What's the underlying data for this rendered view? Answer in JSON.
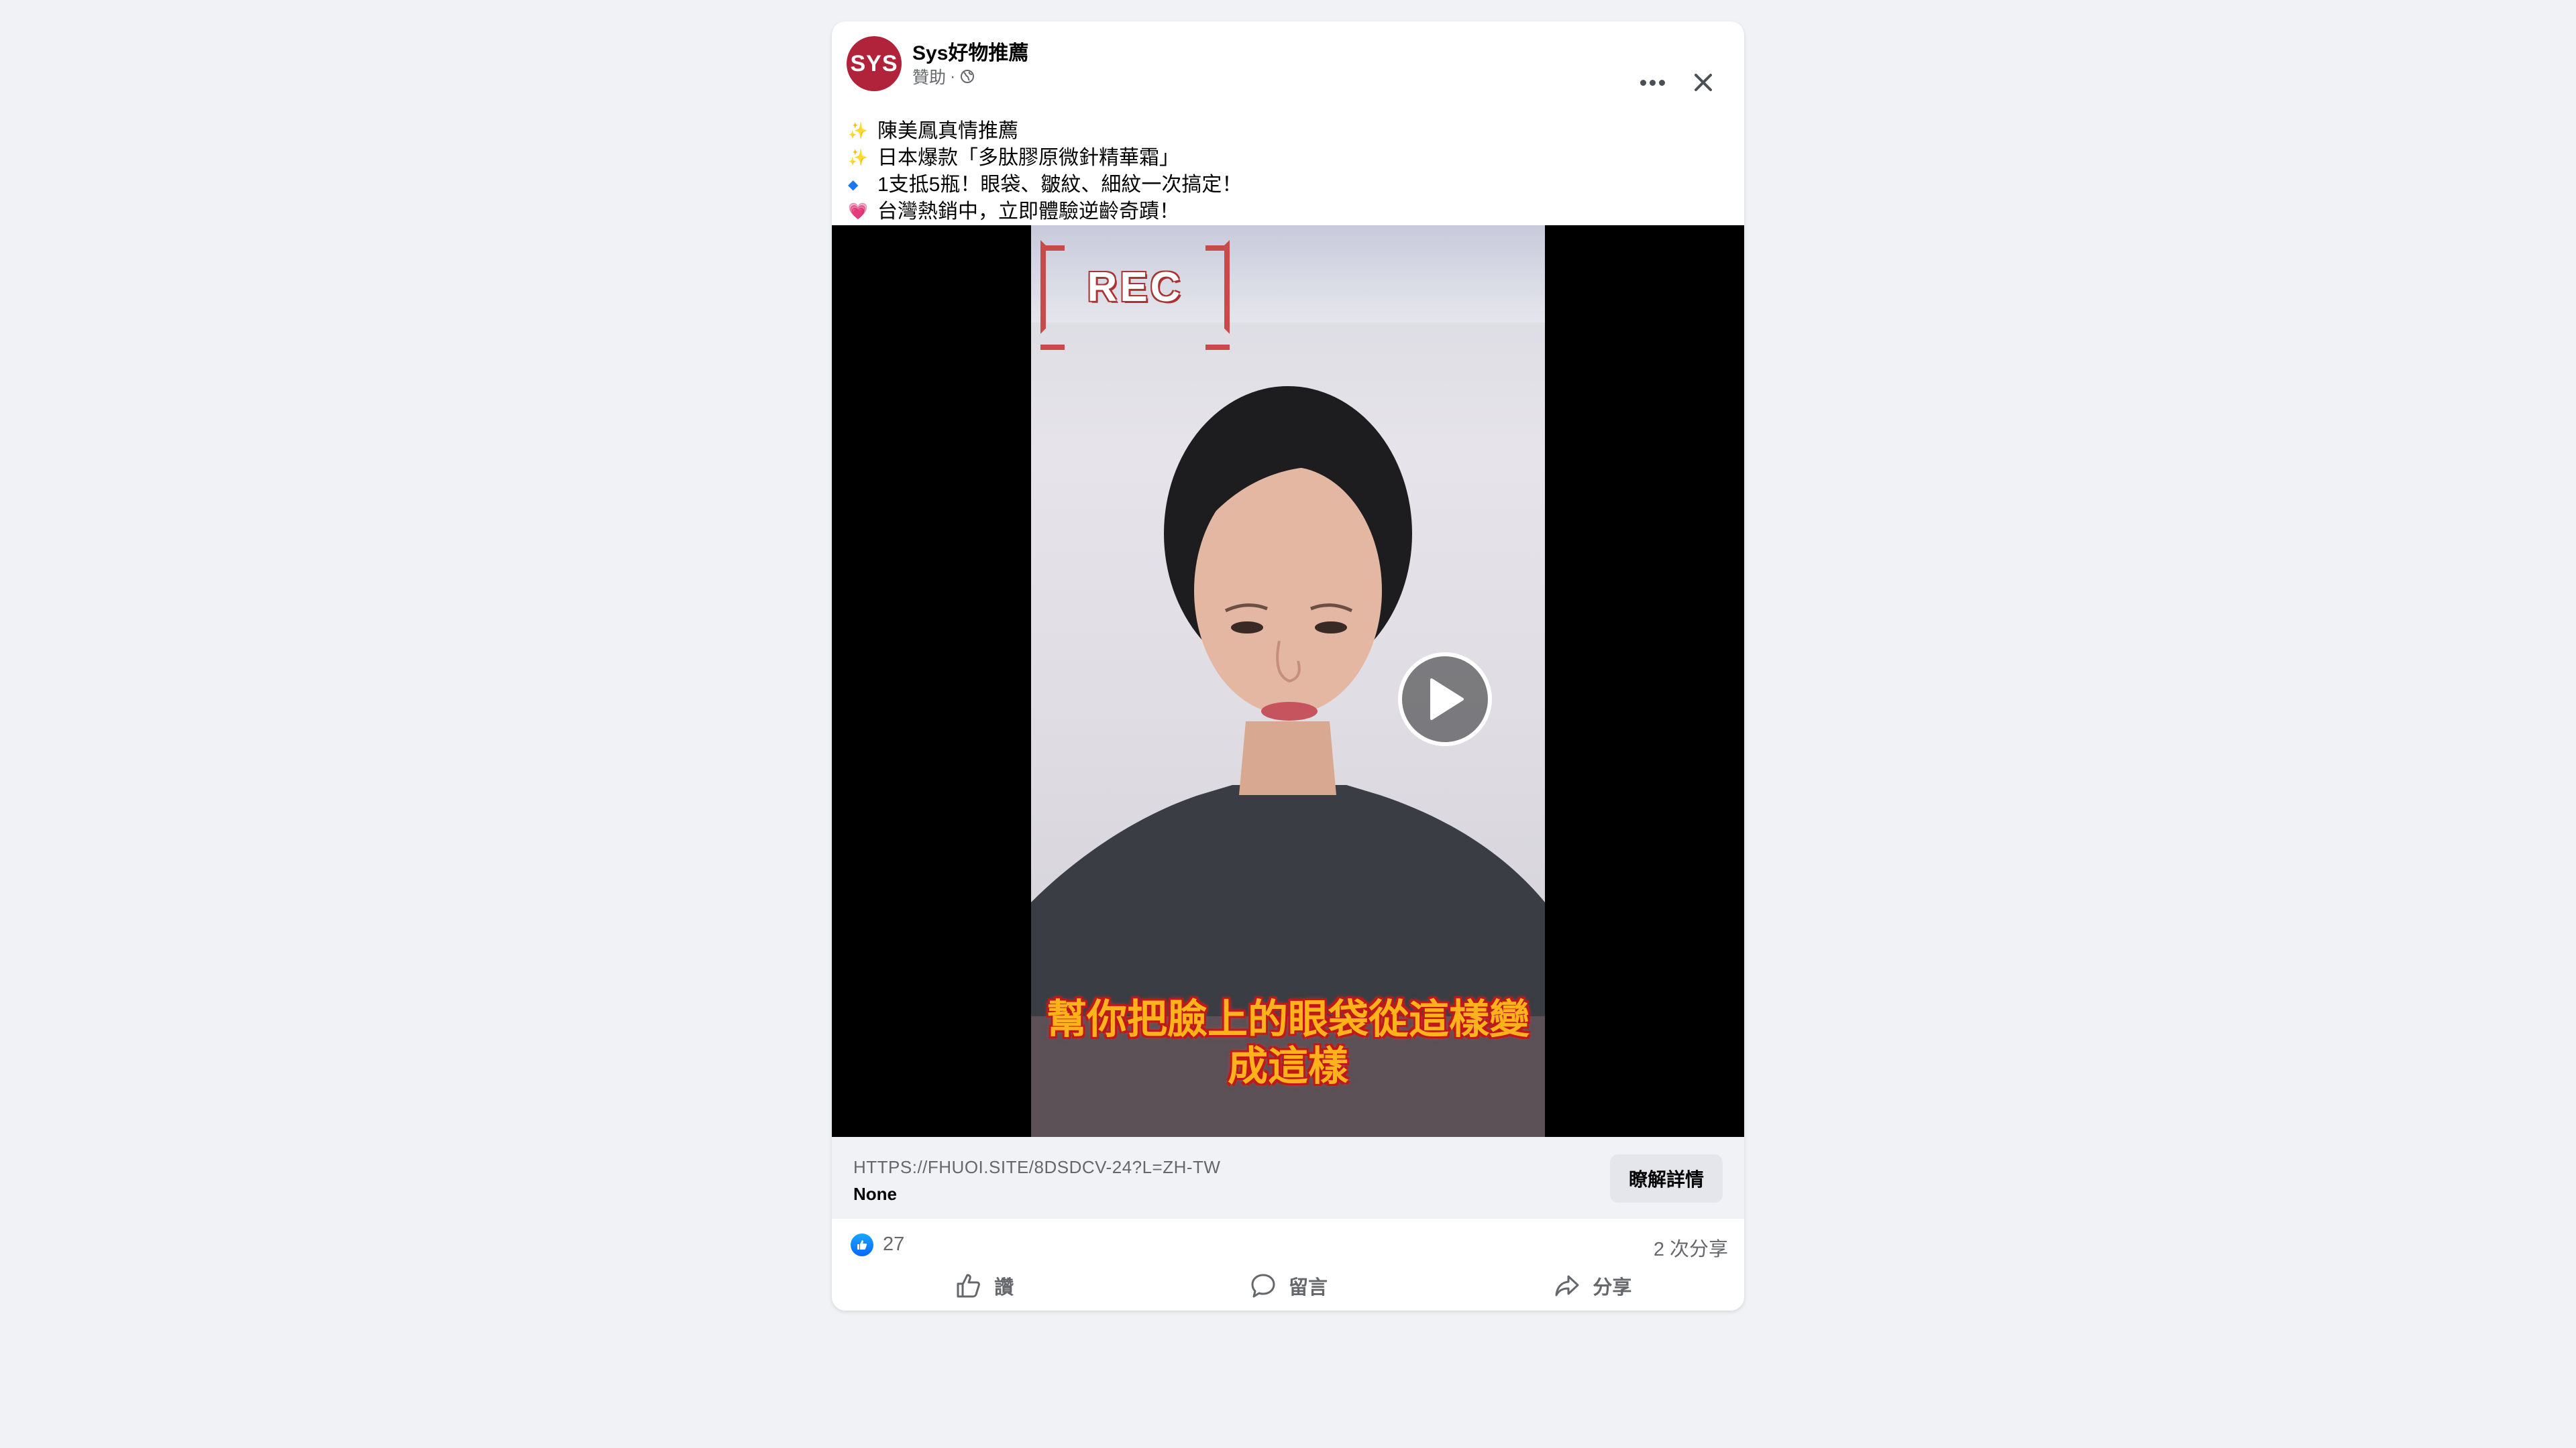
{
  "post": {
    "page_name": "Sys好物推薦",
    "avatar_text": "SYS",
    "sponsored_label": "贊助",
    "meta_separator": "·",
    "icons": [
      "globe-icon",
      "more-icon",
      "close-icon"
    ],
    "text_lines": [
      {
        "emoji": "✨",
        "emoji_name": "sparkles",
        "text": "陳美鳳真情推薦"
      },
      {
        "emoji": "✨",
        "emoji_name": "sparkles",
        "text": "日本爆款「多肽膠原微針精華霜」"
      },
      {
        "emoji": "◆",
        "emoji_name": "blue-diamond",
        "text": "1支抵5瓶！眼袋、皺紋、細紋一次搞定！"
      },
      {
        "emoji": "💗",
        "emoji_name": "heart",
        "text": "台灣熱銷中，立即體驗逆齡奇蹟！"
      }
    ]
  },
  "video": {
    "rec_label": "REC",
    "caption_line1": "幫你把臉上的眼袋從這樣變",
    "caption_line2": "成這樣",
    "play_icon": "play-icon"
  },
  "link": {
    "url": "HTTPS://FHUOI.SITE/8DSDCV-24?L=ZH-TW",
    "title": "None",
    "cta_label": "瞭解詳情"
  },
  "engagement": {
    "reaction_count": "27",
    "share_count": "2 次分享"
  },
  "actions": {
    "like_label": "讚",
    "comment_label": "留言",
    "share_label": "分享"
  },
  "colors": {
    "background": "#f0f2f5",
    "card": "#ffffff",
    "avatar": "#b0233a",
    "like_blue": "#0866ff",
    "muted_text": "#65676b",
    "caption_fill": "#ffb21a",
    "caption_stroke": "#c01818"
  }
}
